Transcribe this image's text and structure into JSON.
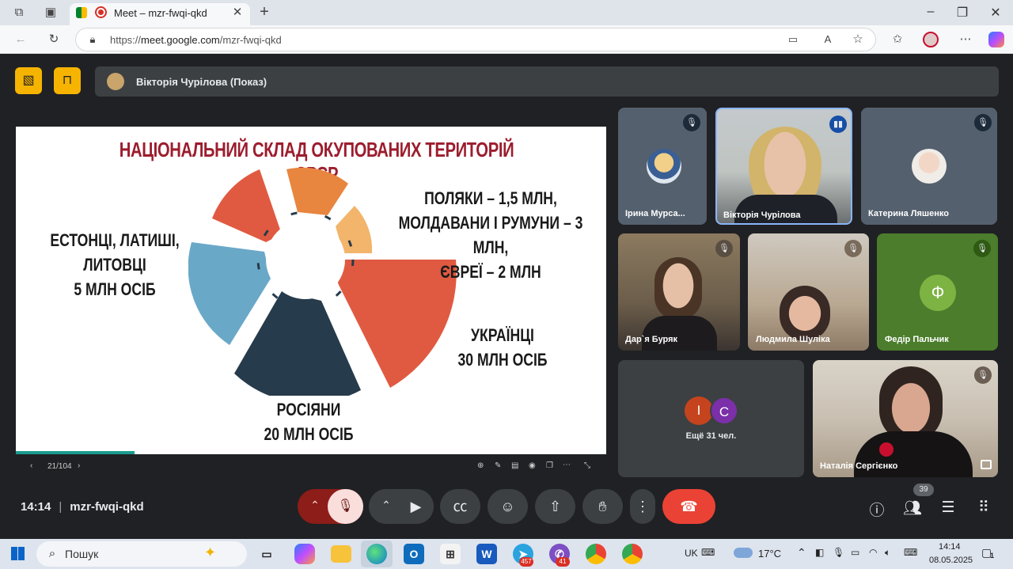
{
  "browser": {
    "tab_title": "Meet – mzr-fwqi-qkd",
    "url_prefix": "https://",
    "url_host": "meet.google.com",
    "url_path": "/mzr-fwqi-qkd",
    "new_tab": "+"
  },
  "meet": {
    "presenter": "Вікторія Чурілова (Показ)",
    "time": "14:14",
    "meeting_code": "mzr-fwqi-qkd",
    "participant_count": "39",
    "more_people": "Ещё 31 чел.",
    "more_avatars": [
      "І",
      "С"
    ]
  },
  "slide": {
    "title": "НАЦІОНАЛЬНИЙ СКЛАД ОКУПОВАНИХ ТЕРИТОРІЙ СРСР",
    "label_left": [
      "ЕСТОНЦІ, ЛАТИШІ,",
      "ЛИТОВЦІ",
      "5 МЛН ОСІБ"
    ],
    "label_right_top": [
      "ПОЛЯКИ – 1,5 МЛН,",
      "МОЛДАВАНИ І РУМУНИ – 3 МЛН,",
      "ЄВРЕЇ – 2 МЛН"
    ],
    "label_right": [
      "УКРАЇНЦІ",
      "30 МЛН ОСІБ"
    ],
    "label_bottom": [
      "РОСІЯНИ",
      "20 МЛН ОСІБ"
    ],
    "page": "21/104",
    "colors": {
      "ukr": "#e05a41",
      "rus": "#263b4b",
      "balt": "#6aa8c8",
      "pol": "#f2b56b",
      "mold": "#e8853f",
      "jew": "#e05a41",
      "title": "#9c1d2e"
    }
  },
  "participants": [
    {
      "name": "Ірина Мурса...",
      "muted": true
    },
    {
      "name": "Вікторія Чурілова",
      "muted": false
    },
    {
      "name": "Катерина Ляшенко",
      "muted": true
    },
    {
      "name": "Дар`я Буряк",
      "muted": true
    },
    {
      "name": "Людмила Шуліка",
      "muted": true
    },
    {
      "name": "Федір Пальчик",
      "muted": true,
      "initial": "Ф"
    },
    {
      "name": "Наталія Сергієнко",
      "muted": true
    }
  ],
  "taskbar": {
    "search": "Пошук",
    "lang": "UK",
    "weather": "17°C",
    "time": "14:14",
    "date": "08.05.2025",
    "telegram_badge": "457",
    "viber_badge": "41",
    "notif": "1"
  }
}
